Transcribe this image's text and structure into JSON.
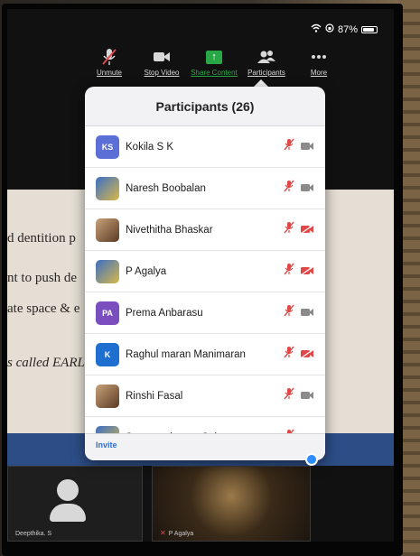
{
  "status_bar": {
    "battery": "87%",
    "battery_level": 0.87
  },
  "toolbar": {
    "items": [
      {
        "label": "Unmute",
        "icon": "mic-muted-icon"
      },
      {
        "label": "Stop Video",
        "icon": "video-camera-icon"
      },
      {
        "label": "Share Content",
        "icon": "share-screen-icon"
      },
      {
        "label": "Participants",
        "icon": "participants-icon"
      },
      {
        "label": "More",
        "icon": "more-dots-icon"
      }
    ]
  },
  "participants_panel": {
    "title": "Participants (26)",
    "invite_label": "Invite",
    "participants": [
      {
        "name": "Kokila S K",
        "avatar": "initials",
        "initials": "KS",
        "avatar_color": "#5b6fd6",
        "mic": "muted",
        "video": "off"
      },
      {
        "name": "Naresh Boobalan",
        "avatar": "photo",
        "mic": "muted",
        "video": "off"
      },
      {
        "name": "Nivethitha Bhaskar",
        "avatar": "photo",
        "mic": "muted",
        "video": "muted"
      },
      {
        "name": "P Agalya",
        "avatar": "photo",
        "mic": "muted",
        "video": "muted"
      },
      {
        "name": "Prema Anbarasu",
        "avatar": "initials",
        "initials": "PA",
        "avatar_color": "#7b4ec0",
        "mic": "muted",
        "video": "off"
      },
      {
        "name": "Raghul maran Manimaran",
        "avatar": "initials",
        "initials": "K",
        "avatar_color": "#1f6fd0",
        "mic": "muted",
        "video": "muted"
      },
      {
        "name": "Rinshi Fasal",
        "avatar": "photo",
        "mic": "muted",
        "video": "off"
      },
      {
        "name": "Saravanakumar Subrama...",
        "avatar": "photo",
        "mic": "muted",
        "video": "muted"
      }
    ]
  },
  "slide": {
    "lines": [
      "d dentition p",
      "nt to push de",
      "ate space & e",
      "s called EARL"
    ]
  },
  "video_tiles": [
    {
      "name": "Deepthika. S"
    },
    {
      "name": "P Agalya"
    }
  ],
  "colors": {
    "muted_red": "#e04848",
    "share_green": "#27a745",
    "link_blue": "#2d6fd6"
  }
}
